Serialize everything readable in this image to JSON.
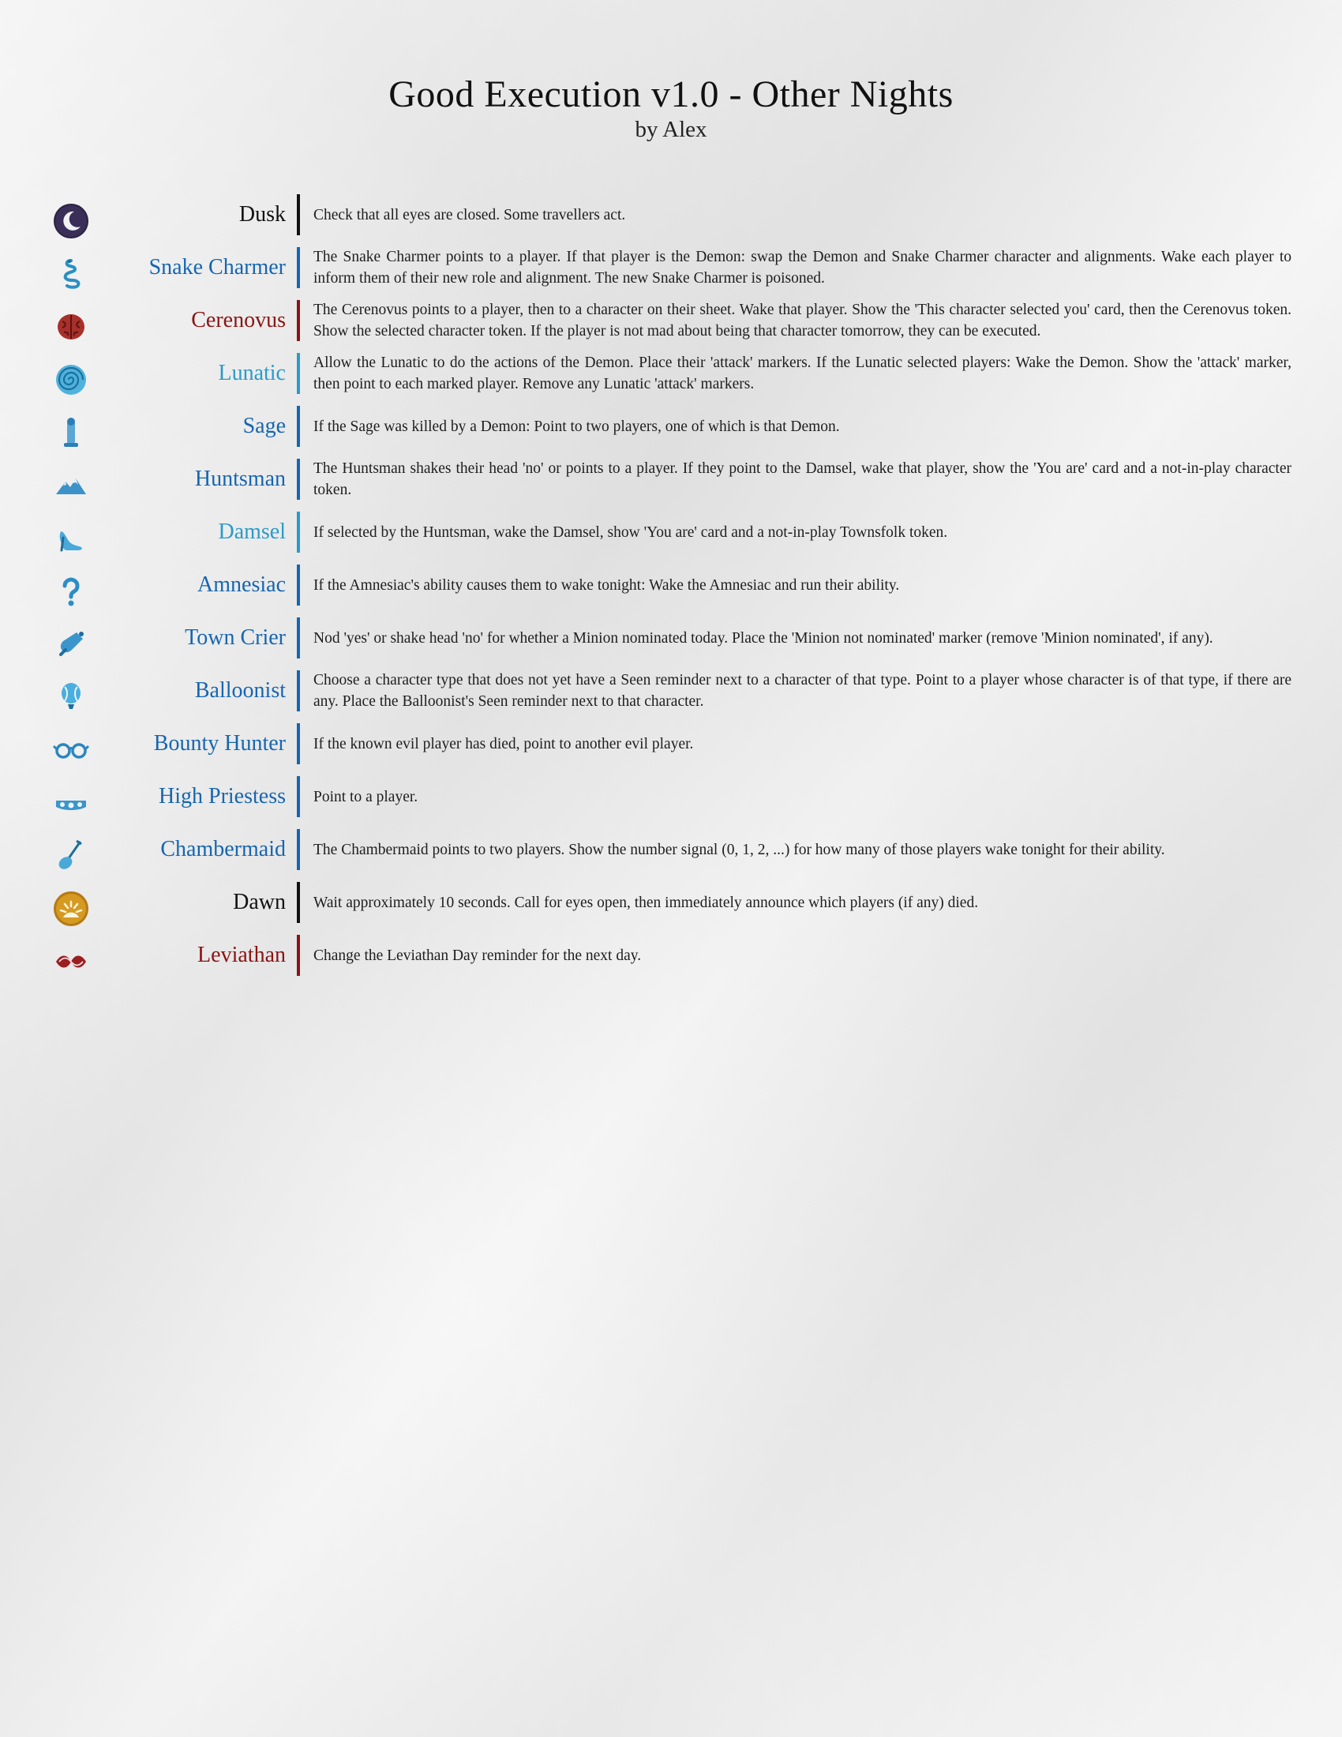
{
  "header": {
    "title": "Good Execution v1.0 - Other Nights",
    "subtitle": "by Alex"
  },
  "colors": {
    "black": "#111111",
    "townsfolk": "#1566b0",
    "outsider": "#2a9bc9",
    "evil": "#8a1414"
  },
  "rows": [
    {
      "name": "Dusk",
      "color": "black",
      "icon": "moon-icon",
      "text": "Check that all eyes are closed. Some travellers act."
    },
    {
      "name": "Snake Charmer",
      "color": "townsfolk",
      "icon": "snake-icon",
      "text": "The Snake Charmer points to a player. If that player is the Demon: swap the Demon and Snake Charmer character and alignments. Wake each player to inform them of their new role and alignment. The new Snake Charmer is poisoned."
    },
    {
      "name": "Cerenovus",
      "color": "evil",
      "icon": "brain-icon",
      "text": "The Cerenovus points to a player, then to a character on their sheet. Wake that player. Show the 'This character selected you' card, then the Cerenovus token. Show the selected character token. If the player is not mad about being that character tomorrow, they can be executed."
    },
    {
      "name": "Lunatic",
      "color": "outsider",
      "icon": "spiral-icon",
      "text": "Allow the Lunatic to do the actions of the Demon. Place their 'attack' markers. If the Lunatic selected players: Wake the Demon. Show the 'attack' marker, then point to each marked player. Remove any Lunatic 'attack' markers."
    },
    {
      "name": "Sage",
      "color": "townsfolk",
      "icon": "sage-figure-icon",
      "text": "If the Sage was killed by a Demon: Point to two players, one of which is that Demon."
    },
    {
      "name": "Huntsman",
      "color": "townsfolk",
      "icon": "mountain-icon",
      "text": "The Huntsman shakes their head 'no' or points to a player. If they point to the Damsel, wake that player, show the 'You are' card and a not-in-play character token."
    },
    {
      "name": "Damsel",
      "color": "outsider",
      "icon": "slipper-icon",
      "text": "If selected by the Huntsman, wake the Damsel, show 'You are' card and a not-in-play Townsfolk token."
    },
    {
      "name": "Amnesiac",
      "color": "townsfolk",
      "icon": "question-mark-icon",
      "text": "If the Amnesiac's ability causes them to wake tonight: Wake the Amnesiac and run their ability."
    },
    {
      "name": "Town Crier",
      "color": "townsfolk",
      "icon": "bell-icon",
      "text": "Nod 'yes' or shake head 'no' for whether a Minion nominated today. Place the 'Minion not nominated' marker (remove 'Minion nominated', if any)."
    },
    {
      "name": "Balloonist",
      "color": "townsfolk",
      "icon": "balloon-icon",
      "text": "Choose a character type that does not yet have a Seen reminder next to a character of that type. Point to a player whose character is of that type, if there are any. Place the Balloonist's Seen reminder next to that character."
    },
    {
      "name": "Bounty Hunter",
      "color": "townsfolk",
      "icon": "spectacles-icon",
      "text": "If the known evil player has died, point to another evil player."
    },
    {
      "name": "High Priestess",
      "color": "townsfolk",
      "icon": "tiara-icon",
      "text": "Point to a player."
    },
    {
      "name": "Chambermaid",
      "color": "townsfolk",
      "icon": "feather-duster-icon",
      "text": "The Chambermaid points to two players. Show the number signal (0, 1, 2, ...) for how many of those players wake tonight for their ability."
    },
    {
      "name": "Dawn",
      "color": "black",
      "icon": "sun-icon",
      "text": "Wait approximately 10 seconds. Call for eyes open, then immediately announce which players (if any) died."
    },
    {
      "name": "Leviathan",
      "color": "evil",
      "icon": "leviathan-icon",
      "text": "Change the Leviathan Day reminder for the next day."
    }
  ]
}
